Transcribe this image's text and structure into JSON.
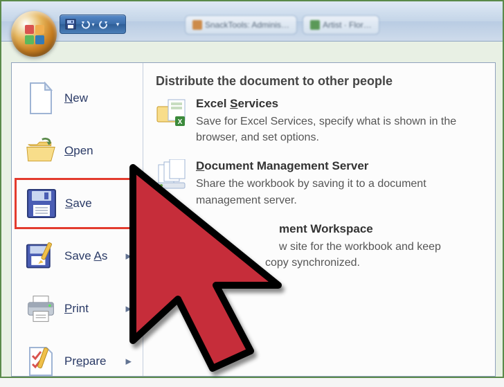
{
  "qat": {
    "save_label": "Save",
    "undo_label": "Undo",
    "redo_label": "Redo"
  },
  "window_tabs": [
    "SnackTools: Adminis…",
    "Artist · Flor…"
  ],
  "menu": {
    "items": [
      {
        "pre": "",
        "acc": "N",
        "post": "ew",
        "has_arrow": false
      },
      {
        "pre": "",
        "acc": "O",
        "post": "pen",
        "has_arrow": false
      },
      {
        "pre": "",
        "acc": "S",
        "post": "ave",
        "has_arrow": false
      },
      {
        "pre": "Save ",
        "acc": "A",
        "post": "s",
        "has_arrow": true
      },
      {
        "pre": "",
        "acc": "P",
        "post": "rint",
        "has_arrow": true
      },
      {
        "pre": "Pr",
        "acc": "e",
        "post": "pare",
        "has_arrow": true
      }
    ]
  },
  "right": {
    "title": "Distribute the document to other people",
    "items": [
      {
        "title_pre": "Excel ",
        "title_acc": "S",
        "title_post": "ervices",
        "desc": "Save for Excel Services, specify what is shown in the browser, and set options."
      },
      {
        "title_pre": "",
        "title_acc": "D",
        "title_post": "ocument Management Server",
        "desc": "Share the workbook by saving it to a document management server."
      },
      {
        "title_pre": "",
        "title_acc": "",
        "title_post": "ment Workspace",
        "desc_a": "w site for the workbook and keep",
        "desc_b": "copy synchronized."
      }
    ]
  }
}
